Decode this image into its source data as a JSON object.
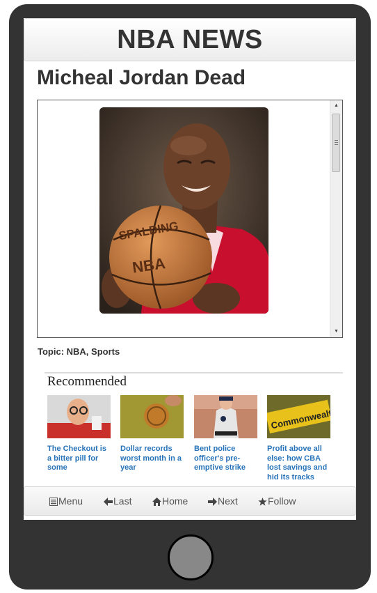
{
  "header": {
    "title": "NBA NEWS"
  },
  "article": {
    "title": "Micheal Jordan Dead",
    "topic": "Topic: NBA, Sports"
  },
  "recommended": {
    "heading": "Recommended",
    "items": [
      {
        "caption": "The Checkout is a bitter pill for some"
      },
      {
        "caption": "Dollar records worst month in a year"
      },
      {
        "caption": "Bent police officer's pre-emptive strike"
      },
      {
        "caption": "Profit above all else: how CBA lost savings and hid its tracks"
      }
    ]
  },
  "footer": {
    "buttons": [
      {
        "label": "Menu",
        "icon": "list-icon"
      },
      {
        "label": "Last",
        "icon": "arrow-left-icon"
      },
      {
        "label": "Home",
        "icon": "home-icon"
      },
      {
        "label": "Next",
        "icon": "arrow-right-icon"
      },
      {
        "label": "Follow",
        "icon": "star-icon"
      }
    ]
  },
  "colors": {
    "device": "#333333",
    "link": "#2773b9",
    "text": "#333333"
  }
}
